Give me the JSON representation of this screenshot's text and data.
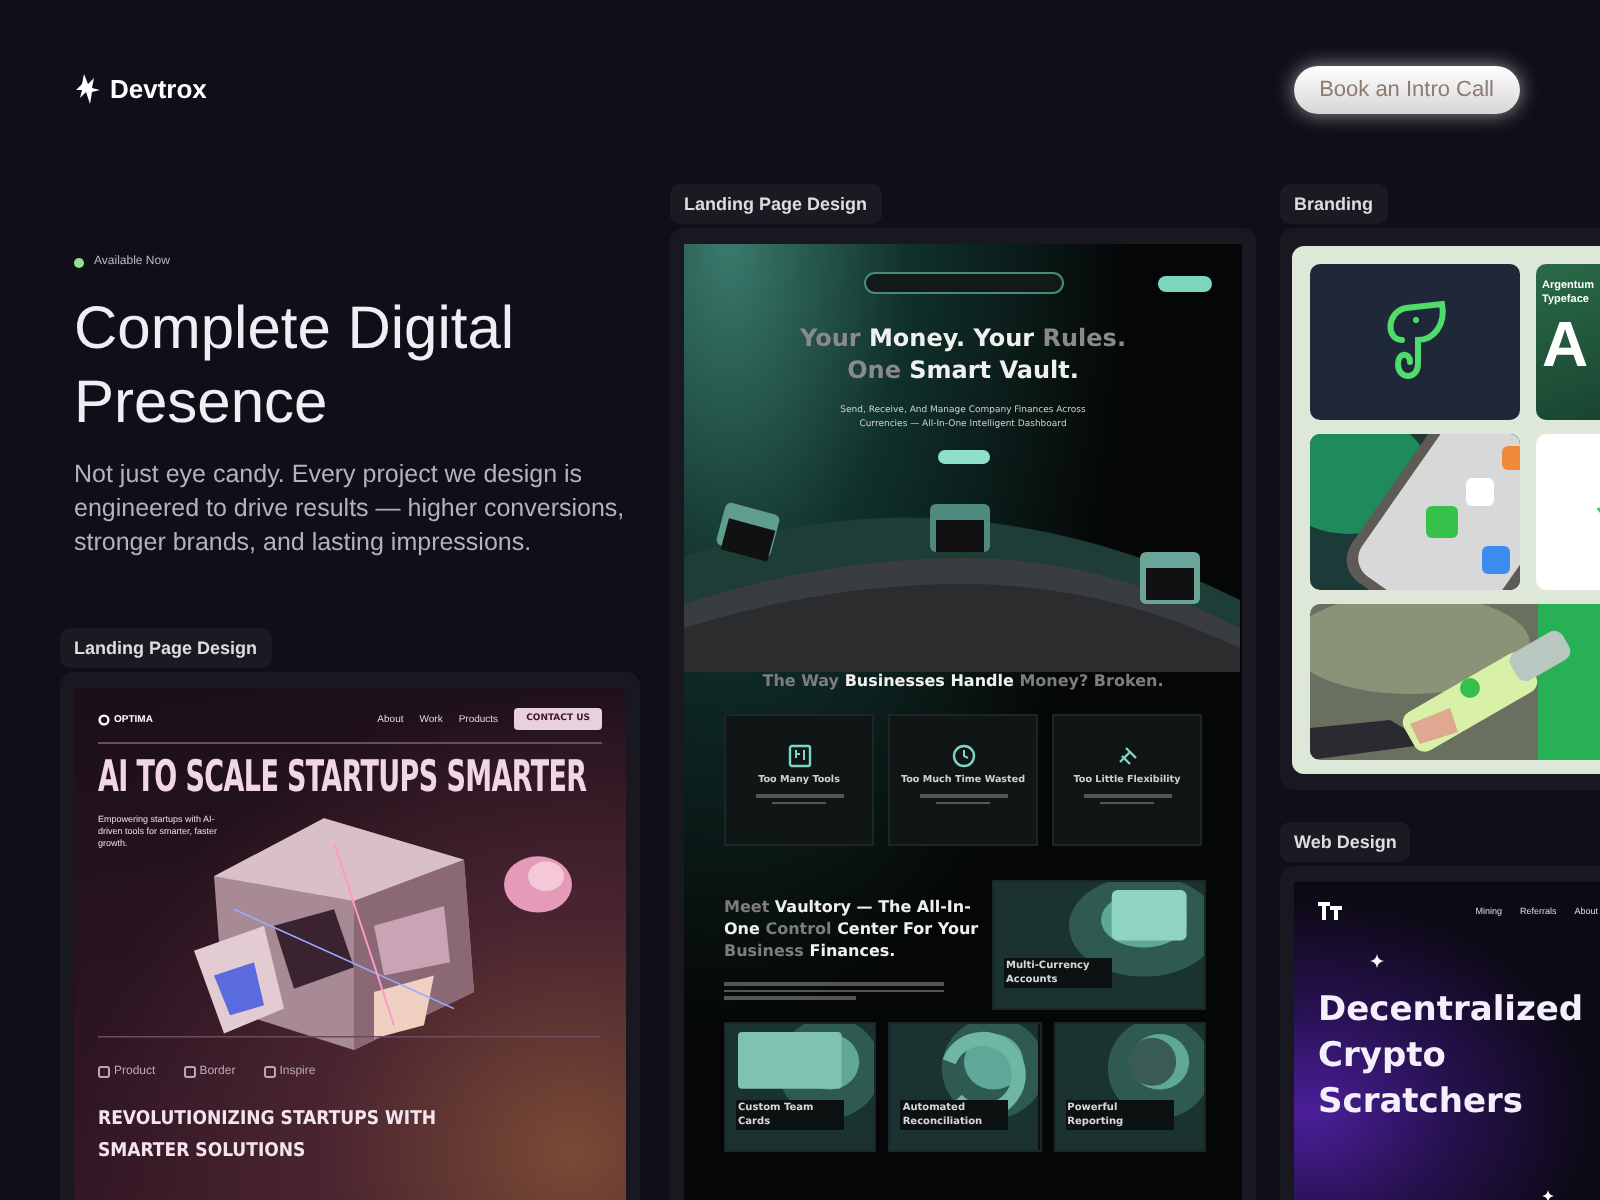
{
  "brand": {
    "name": "Devtrox"
  },
  "header": {
    "cta": "Book an Intro Call"
  },
  "hero": {
    "status": "Available Now",
    "title": "Complete Digital Presence",
    "description": "Not just eye candy. Every project we design is engineered to drive results — higher conversions, stronger brands, and lasting impressions."
  },
  "projects": [
    {
      "category": "Landing Page Design",
      "kind": "startup",
      "logo": "OPTIMA",
      "nav": [
        "About",
        "Work",
        "Products"
      ],
      "button": "CONTACT US",
      "headline": "AI TO SCALE STARTUPS SMARTER",
      "intro": "Empowering startups with AI-driven tools for smarter, faster growth.",
      "partners": [
        "Product",
        "Border",
        "Inspire"
      ],
      "section_title": "REVOLUTIONIZING STARTUPS WITH SMARTER SOLUTIONS"
    },
    {
      "category": "Landing Page Design",
      "kind": "finance",
      "headline": [
        "Your **Money. Your** Rules.",
        "One **Smart Vault.**"
      ],
      "subheadline": "Send, Receive, And Manage Company Finances Across Currencies — All-In-One Intelligent Dashboard",
      "problem_title": "The Way **Businesses Handle** Money? Broken.",
      "problems": [
        "Too Many Tools",
        "Too Much Time Wasted",
        "Too Little Flexibility"
      ],
      "feature_title": "Meet **Vaultory — The All-In-One** Control **Center For Your** Business **Finances.**",
      "features": [
        "Multi-Currency Accounts",
        "Custom Team Cards",
        "Automated Reconciliation",
        "Powerful Reporting"
      ]
    },
    {
      "category": "Branding",
      "kind": "branding",
      "type_name": "Argentum Typeface",
      "type_sample": "A"
    },
    {
      "category": "Web Design",
      "kind": "crypto",
      "nav": [
        "Mining",
        "Referrals",
        "About"
      ],
      "headline": "Decentralized Crypto Scratchers"
    }
  ]
}
